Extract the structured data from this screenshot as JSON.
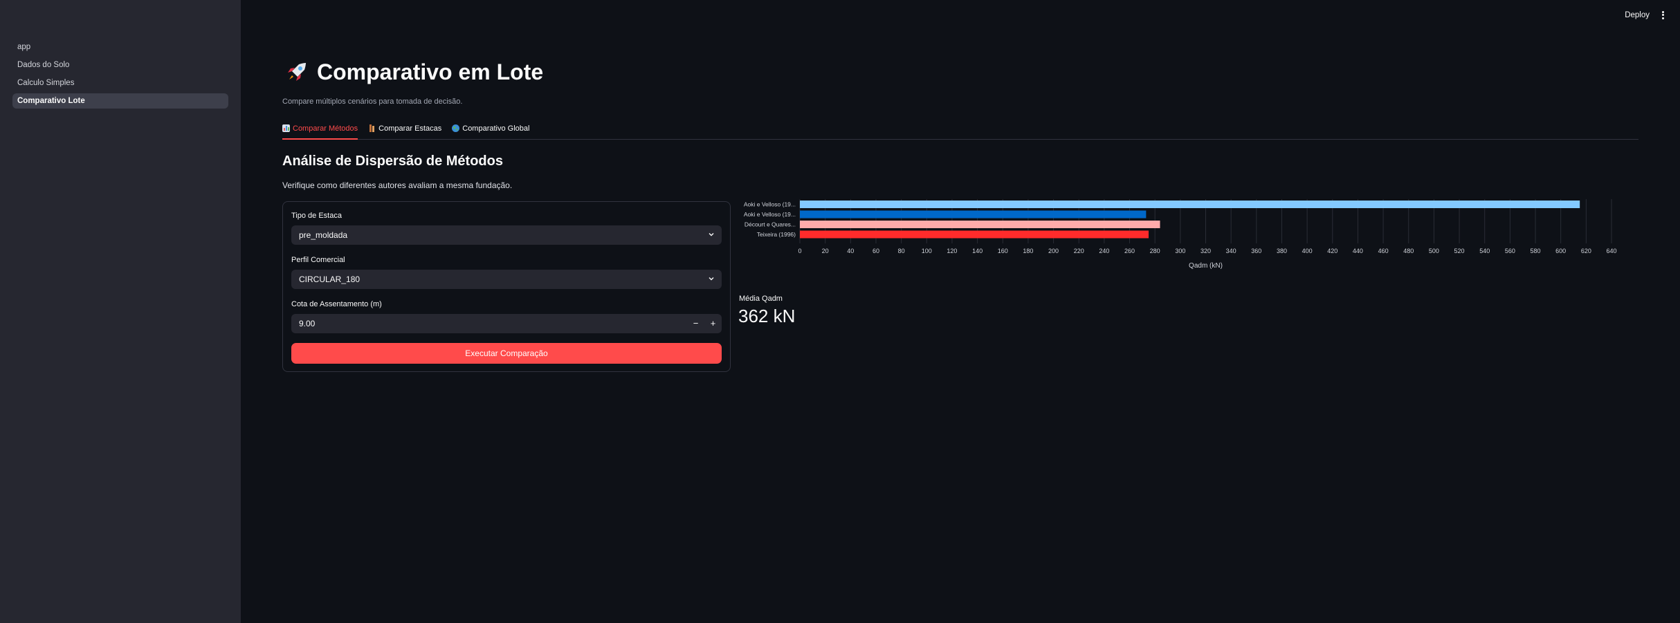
{
  "sidebar": {
    "items": [
      {
        "label": "app",
        "active": false
      },
      {
        "label": "Dados do Solo",
        "active": false
      },
      {
        "label": "Calculo Simples",
        "active": false
      },
      {
        "label": "Comparativo Lote",
        "active": true
      }
    ]
  },
  "topbar": {
    "deploy_label": "Deploy",
    "menu_icon": "more-vertical-icon"
  },
  "page": {
    "title": "Comparativo em Lote",
    "title_icon": "rocket-icon",
    "subtitle": "Compare múltiplos cenários para tomada de decisão."
  },
  "tabs": [
    {
      "label": "Comparar Métodos",
      "icon": "bar-chart-icon",
      "active": true
    },
    {
      "label": "Comparar Estacas",
      "icon": "pile-icon",
      "active": false
    },
    {
      "label": "Comparativo Global",
      "icon": "globe-icon",
      "active": false
    }
  ],
  "section": {
    "title": "Análise de Dispersão de Métodos",
    "description": "Verifique como diferentes autores avaliam a mesma fundação."
  },
  "form": {
    "tipo_label": "Tipo de Estaca",
    "tipo_value": "pre_moldada",
    "perfil_label": "Perfil Comercial",
    "perfil_value": "CIRCULAR_180",
    "cota_label": "Cota de Assentamento (m)",
    "cota_value": "9.00",
    "minus_label": "−",
    "plus_label": "+",
    "run_label": "Executar Comparação"
  },
  "metric": {
    "label": "Média Qadm",
    "value": "362 kN"
  },
  "colors": {
    "accent": "#ff4b4b",
    "bg": "#0e1117",
    "sidebar": "#262730"
  },
  "chart_data": {
    "type": "bar",
    "orientation": "horizontal",
    "categories": [
      "Aoki e Velloso (19...",
      "Aoki e Velloso (19...",
      "Décourt e Quares...",
      "Teixeira (1996)"
    ],
    "values": [
      615,
      273,
      284,
      275
    ],
    "colors": [
      "#83c9ff",
      "#0068c9",
      "#ffabab",
      "#ff2b2b"
    ],
    "xlabel": "Qadm (kN)",
    "xlim": [
      0,
      640
    ],
    "xticks": [
      0,
      20,
      40,
      60,
      80,
      100,
      120,
      140,
      160,
      180,
      200,
      220,
      240,
      260,
      280,
      300,
      320,
      340,
      360,
      380,
      400,
      420,
      440,
      460,
      480,
      500,
      520,
      540,
      560,
      580,
      600,
      620,
      640
    ],
    "grid": true
  }
}
